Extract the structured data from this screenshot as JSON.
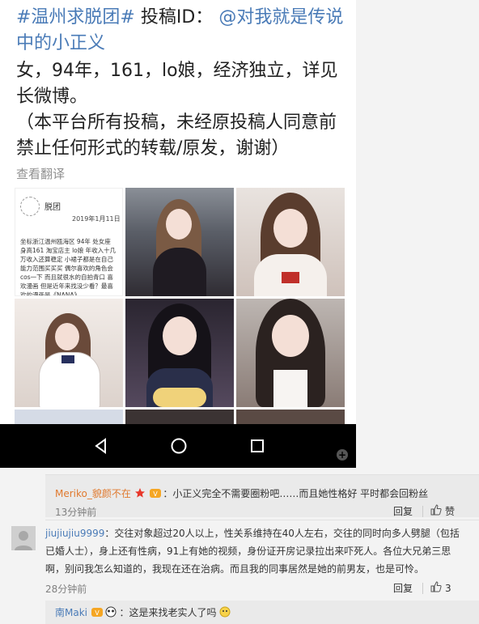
{
  "post": {
    "hashtag": "#温州求脱团#",
    "id_label": "投稿ID：",
    "mention_line1": "@对我就是传说",
    "mention_line2": "中的小正义",
    "body": "女，94年，161，lo娘，经济独立，详见长微博。",
    "notice": "（本平台所有投稿，未经原投稿人同意前禁止任何形式的转载/原发，谢谢）",
    "translate": "查看翻译"
  },
  "note_image": {
    "title": "脱团",
    "date": "2019年1月11日",
    "text": "坐标浙江温州瓯海区 94年 处女座 身高161 淘宝店主 lo娘 年收入十几万收入还算稳定 小裙子都是在自己能力范围买买买 偶尔喜欢的角色会cos一下 而且就很水的自拍青口 喜欢漫画 但是近年来找没少看？最喜欢的漫画是《NANA》"
  },
  "navbar": {
    "back_icon": "back-triangle-icon",
    "home_icon": "home-circle-icon",
    "recent_icon": "recent-square-icon",
    "plus": "+"
  },
  "comments": [
    {
      "user": "Meriko_貌颜不在",
      "text": "：小正义完全不需要圈粉吧……而且她性格好 平时都会回粉丝",
      "time": "13分钟前",
      "reply": "回复",
      "like": "赞"
    },
    {
      "user": "jiujiujiu9999",
      "text": "：交往对象超过20人以上，性关系维持在40人左右，交往的同时向多人劈腿（包括已婚人士），身上还有性病，91上有她的视频，身份证开房记录拉出来吓死人。各位大兄弟三思啊，别问我怎么知道的，我现在还在治病。而且我的同事居然是她的前男友，也是可怜。",
      "time": "28分钟前",
      "reply": "回复",
      "like": "3"
    },
    {
      "user": "南Maki",
      "text": "：这是来找老实人了吗"
    }
  ],
  "colors": {
    "link": "#4a7bb7",
    "orange_user": "#e07a2f",
    "meta_gray": "#808080"
  }
}
